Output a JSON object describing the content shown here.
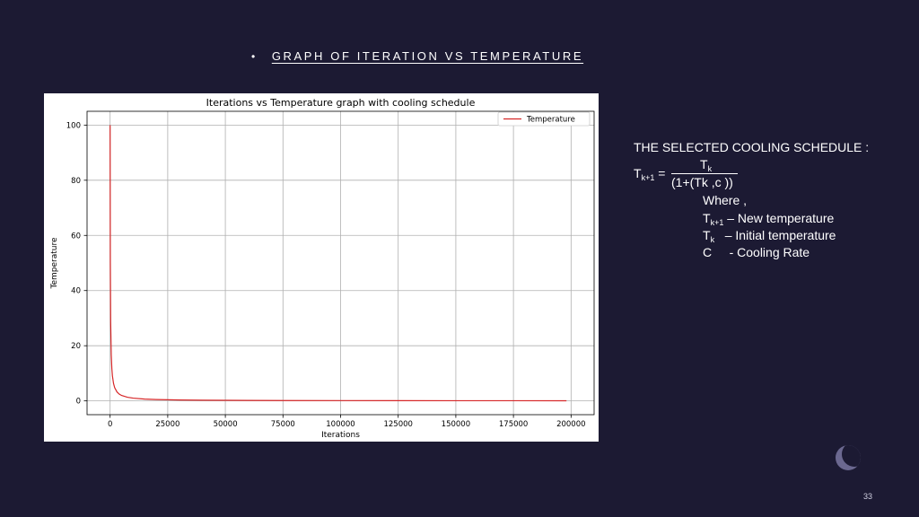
{
  "slide": {
    "bullet": "•",
    "heading": "GRAPH OF ITERATION VS TEMPERATURE",
    "page_number": "33"
  },
  "schedule": {
    "title": "THE SELECTED COOLING SCHEDULE :",
    "lhs_T": "T",
    "lhs_sub": "k+1",
    "equals": "=",
    "num_T": "T",
    "num_sub": "k",
    "denominator": "(1+(Tk ,c ))",
    "where": "Where ,",
    "def1_T": "T",
    "def1_sub": "k+1",
    "def1_text": "– New temperature",
    "def2_T": "T",
    "def2_sub": "k",
    "def2_text": "– Initial temperature",
    "def3_sym": "C",
    "def3_text": "- Cooling Rate"
  },
  "chart_data": {
    "type": "line",
    "title": "Iterations vs Temperature graph with cooling schedule",
    "xlabel": "Iterations",
    "ylabel": "Temperature",
    "xlim": [
      -10000,
      210000
    ],
    "ylim": [
      -5,
      105
    ],
    "xticks": [
      0,
      25000,
      50000,
      75000,
      100000,
      125000,
      150000,
      175000,
      200000
    ],
    "yticks": [
      0,
      20,
      40,
      60,
      80,
      100
    ],
    "grid": true,
    "legend_position": "top-right",
    "series": [
      {
        "name": "Temperature",
        "color": "#d62728",
        "x": [
          0,
          100,
          250,
          500,
          750,
          1000,
          1500,
          2000,
          3000,
          4000,
          5000,
          7500,
          10000,
          15000,
          20000,
          25000,
          30000,
          40000,
          50000,
          60000,
          75000,
          100000,
          125000,
          150000,
          175000,
          198000
        ],
        "y": [
          100,
          50,
          28.6,
          16.7,
          11.8,
          9.1,
          6.25,
          4.76,
          3.23,
          2.44,
          1.96,
          1.32,
          0.99,
          0.66,
          0.5,
          0.4,
          0.33,
          0.25,
          0.2,
          0.17,
          0.13,
          0.1,
          0.08,
          0.067,
          0.057,
          0.05
        ]
      }
    ]
  }
}
